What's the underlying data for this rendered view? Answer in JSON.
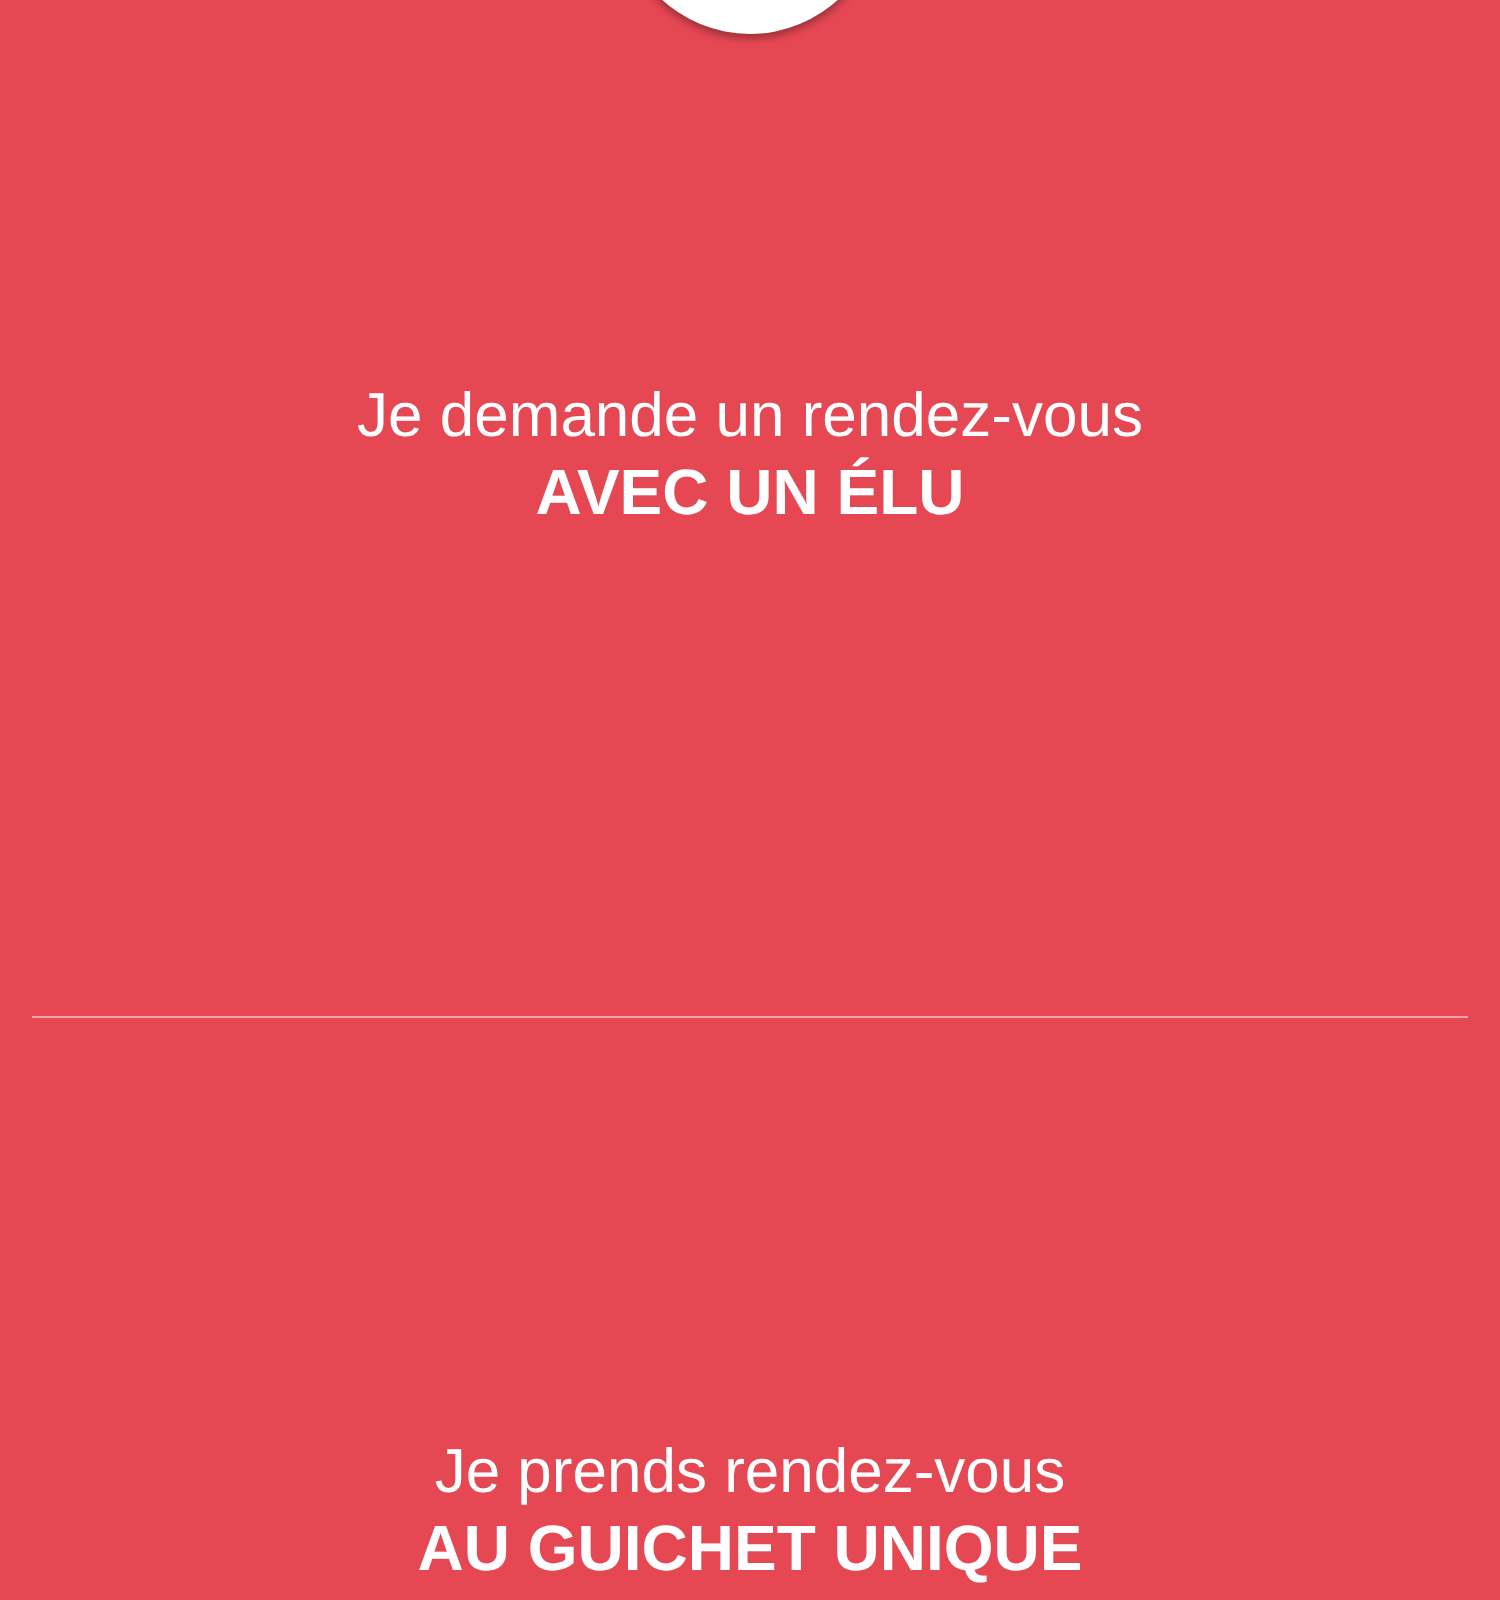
{
  "sections": [
    {
      "lead": "Je demande un rendez-vous",
      "title": "AVEC UN ÉLU"
    },
    {
      "lead": "Je prends rendez-vous",
      "title": "AU GUICHET UNIQUE"
    }
  ]
}
